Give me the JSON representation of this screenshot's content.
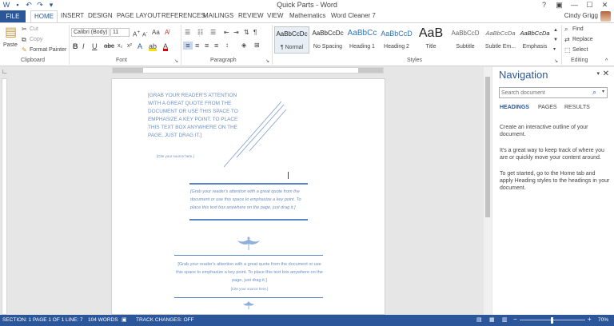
{
  "window": {
    "title": "Quick Parts - Word",
    "controls": [
      "?",
      "▣",
      "—",
      "☐",
      "✕"
    ]
  },
  "tabs": {
    "file": "FILE",
    "items": [
      "HOME",
      "INSERT",
      "DESIGN",
      "PAGE LAYOUT",
      "REFERENCES",
      "MAILINGS",
      "REVIEW",
      "VIEW",
      "Mathematics",
      "Word Cleaner 7"
    ],
    "user": "Cindy Grigg"
  },
  "ribbon": {
    "clipboard": {
      "label": "Clipboard",
      "paste": "Paste",
      "cut": "Cut",
      "copy": "Copy",
      "format_painter": "Format Painter"
    },
    "font": {
      "label": "Font",
      "name": "Calibri (Body)",
      "size": "11"
    },
    "paragraph": {
      "label": "Paragraph"
    },
    "styles": {
      "label": "Styles",
      "items": [
        {
          "preview": "AaBbCcDc",
          "name": "¶ Normal"
        },
        {
          "preview": "AaBbCcDc",
          "name": "No Spacing"
        },
        {
          "preview": "AaBbCc",
          "name": "Heading 1"
        },
        {
          "preview": "AaBbCcD",
          "name": "Heading 2"
        },
        {
          "preview": "AaB",
          "name": "Title"
        },
        {
          "preview": "AaBbCcD",
          "name": "Subtitle"
        },
        {
          "preview": "AaBbCcDa",
          "name": "Subtle Em..."
        },
        {
          "preview": "AaBbCcDa",
          "name": "Emphasis"
        }
      ]
    },
    "editing": {
      "label": "Editing",
      "find": "Find",
      "replace": "Replace",
      "select": "Select"
    }
  },
  "document": {
    "quote1": "[GRAB YOUR READER'S ATTENTION WITH A GREAT QUOTE FROM THE DOCUMENT OR USE THIS SPACE TO EMPHASIZE A KEY POINT. TO PLACE THIS TEXT BOX ANYWHERE ON THE PAGE, JUST DRAG IT.]",
    "quote1_source": "[Cite your source here.]",
    "quote2": "[Grab your reader's attention with a great quote from the document or use this space to emphasize a key point. To place this text box anywhere on the page, just drag it.]",
    "quote3": "[Grab your reader's attention with a great quote from the document or use this space to emphasize a key point. To place this text box anywhere on the page, just drag it.]",
    "quote3_source": "[Cite your source here.]"
  },
  "navigation": {
    "title": "Navigation",
    "search_placeholder": "Search document",
    "tabs": [
      "HEADINGS",
      "PAGES",
      "RESULTS"
    ],
    "p1": "Create an interactive outline of your document.",
    "p2": "It's a great way to keep track of where you are or quickly move your content around.",
    "p3": "To get started, go to the Home tab and apply Heading styles to the headings in your document."
  },
  "status": {
    "section": "SECTION: 1",
    "page": "PAGE 1 OF 1",
    "line": "LINE: 7",
    "words": "104 WORDS",
    "track": "TRACK CHANGES: OFF",
    "zoom": "70%"
  },
  "colors": {
    "accent": "#2b579a",
    "quote": "#6b8fc4"
  }
}
